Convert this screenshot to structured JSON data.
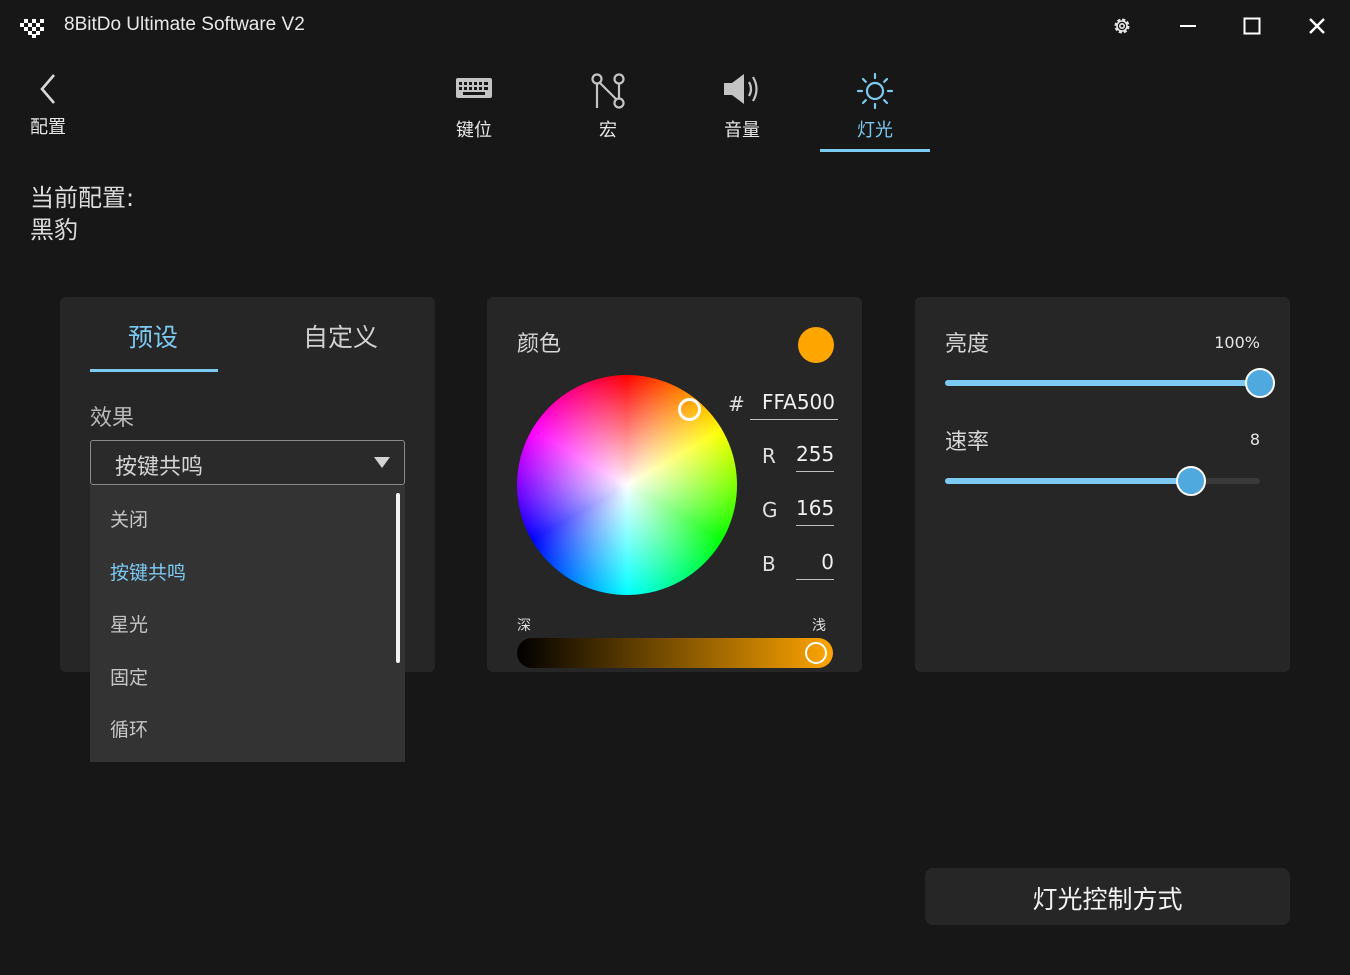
{
  "app": {
    "title": "8BitDo Ultimate Software V2"
  },
  "back": {
    "label": "配置"
  },
  "nav": {
    "tabs": [
      {
        "label": "键位",
        "icon": "keyboard-icon"
      },
      {
        "label": "宏",
        "icon": "macro-icon"
      },
      {
        "label": "音量",
        "icon": "speaker-icon"
      },
      {
        "label": "灯光",
        "icon": "sun-icon",
        "active": true
      }
    ]
  },
  "profile": {
    "label": "当前配置:",
    "name": "黑豹"
  },
  "effects": {
    "tabs": [
      "预设",
      "自定义"
    ],
    "title": "效果",
    "selected": "按键共鸣",
    "options": [
      "关闭",
      "按键共鸣",
      "星光",
      "固定",
      "循环"
    ]
  },
  "color": {
    "title": "颜色",
    "hash_symbol": "#",
    "hex": "FFA500",
    "r_label": "R",
    "r": "255",
    "g_label": "G",
    "g": "165",
    "b_label": "B",
    "b": "0",
    "dark_label": "深",
    "light_label": "浅",
    "swatch": "#FFA500",
    "shade_level": 1.0
  },
  "brightness": {
    "label": "亮度",
    "value": "100%",
    "level": 1.0
  },
  "speed": {
    "label": "速率",
    "value": "8",
    "level": 0.78
  },
  "light_control_button": "灯光控制方式",
  "colors": {
    "accent": "#7ccaf2",
    "thumb": "#4fa9df",
    "panel": "#262626",
    "background": "#171717"
  }
}
